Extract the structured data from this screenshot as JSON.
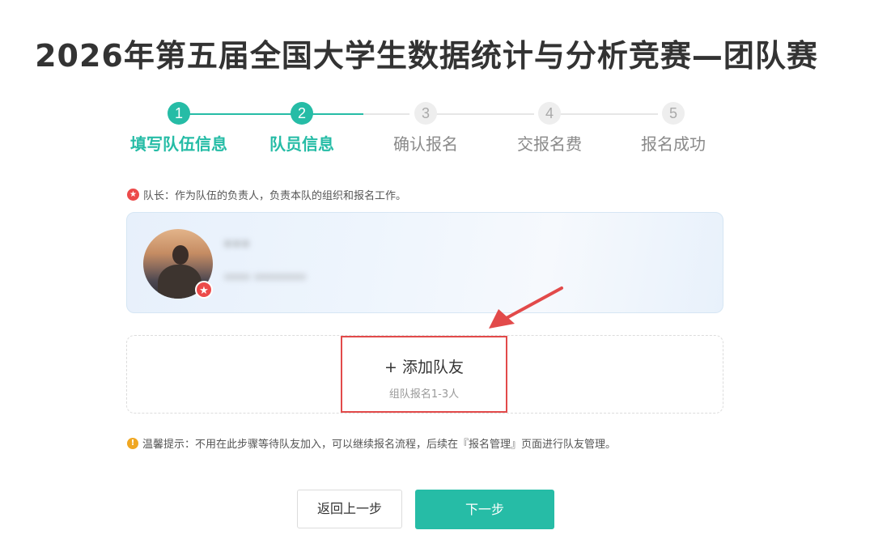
{
  "page": {
    "title": "2026年第五届全国大学生数据统计与分析竞赛—团队赛"
  },
  "steps": [
    {
      "number": "1",
      "label": "填写队伍信息",
      "state": "done"
    },
    {
      "number": "2",
      "label": "队员信息",
      "state": "done"
    },
    {
      "number": "3",
      "label": "确认报名",
      "state": "todo"
    },
    {
      "number": "4",
      "label": "交报名费",
      "state": "todo"
    },
    {
      "number": "5",
      "label": "报名成功",
      "state": "todo"
    }
  ],
  "captain": {
    "note": "队长：作为队伍的负责人，负责本队的组织和报名工作。",
    "name": "***",
    "contact": "****  ********"
  },
  "add_teammate": {
    "label": "+ 添加队友",
    "sub": "组队报名1-3人"
  },
  "tip": {
    "text": "温馨提示：不用在此步骤等待队友加入，可以继续报名流程，后续在『报名管理』页面进行队友管理。"
  },
  "buttons": {
    "back": "返回上一步",
    "next": "下一步"
  },
  "colors": {
    "accent": "#26bca6",
    "captain_star": "#ec4a4a",
    "highlight_border": "#e24a4a",
    "warning": "#f0a722"
  },
  "icons": {
    "captain": "star-icon",
    "tip": "exclamation-icon",
    "annotation": "red-arrow-icon"
  }
}
